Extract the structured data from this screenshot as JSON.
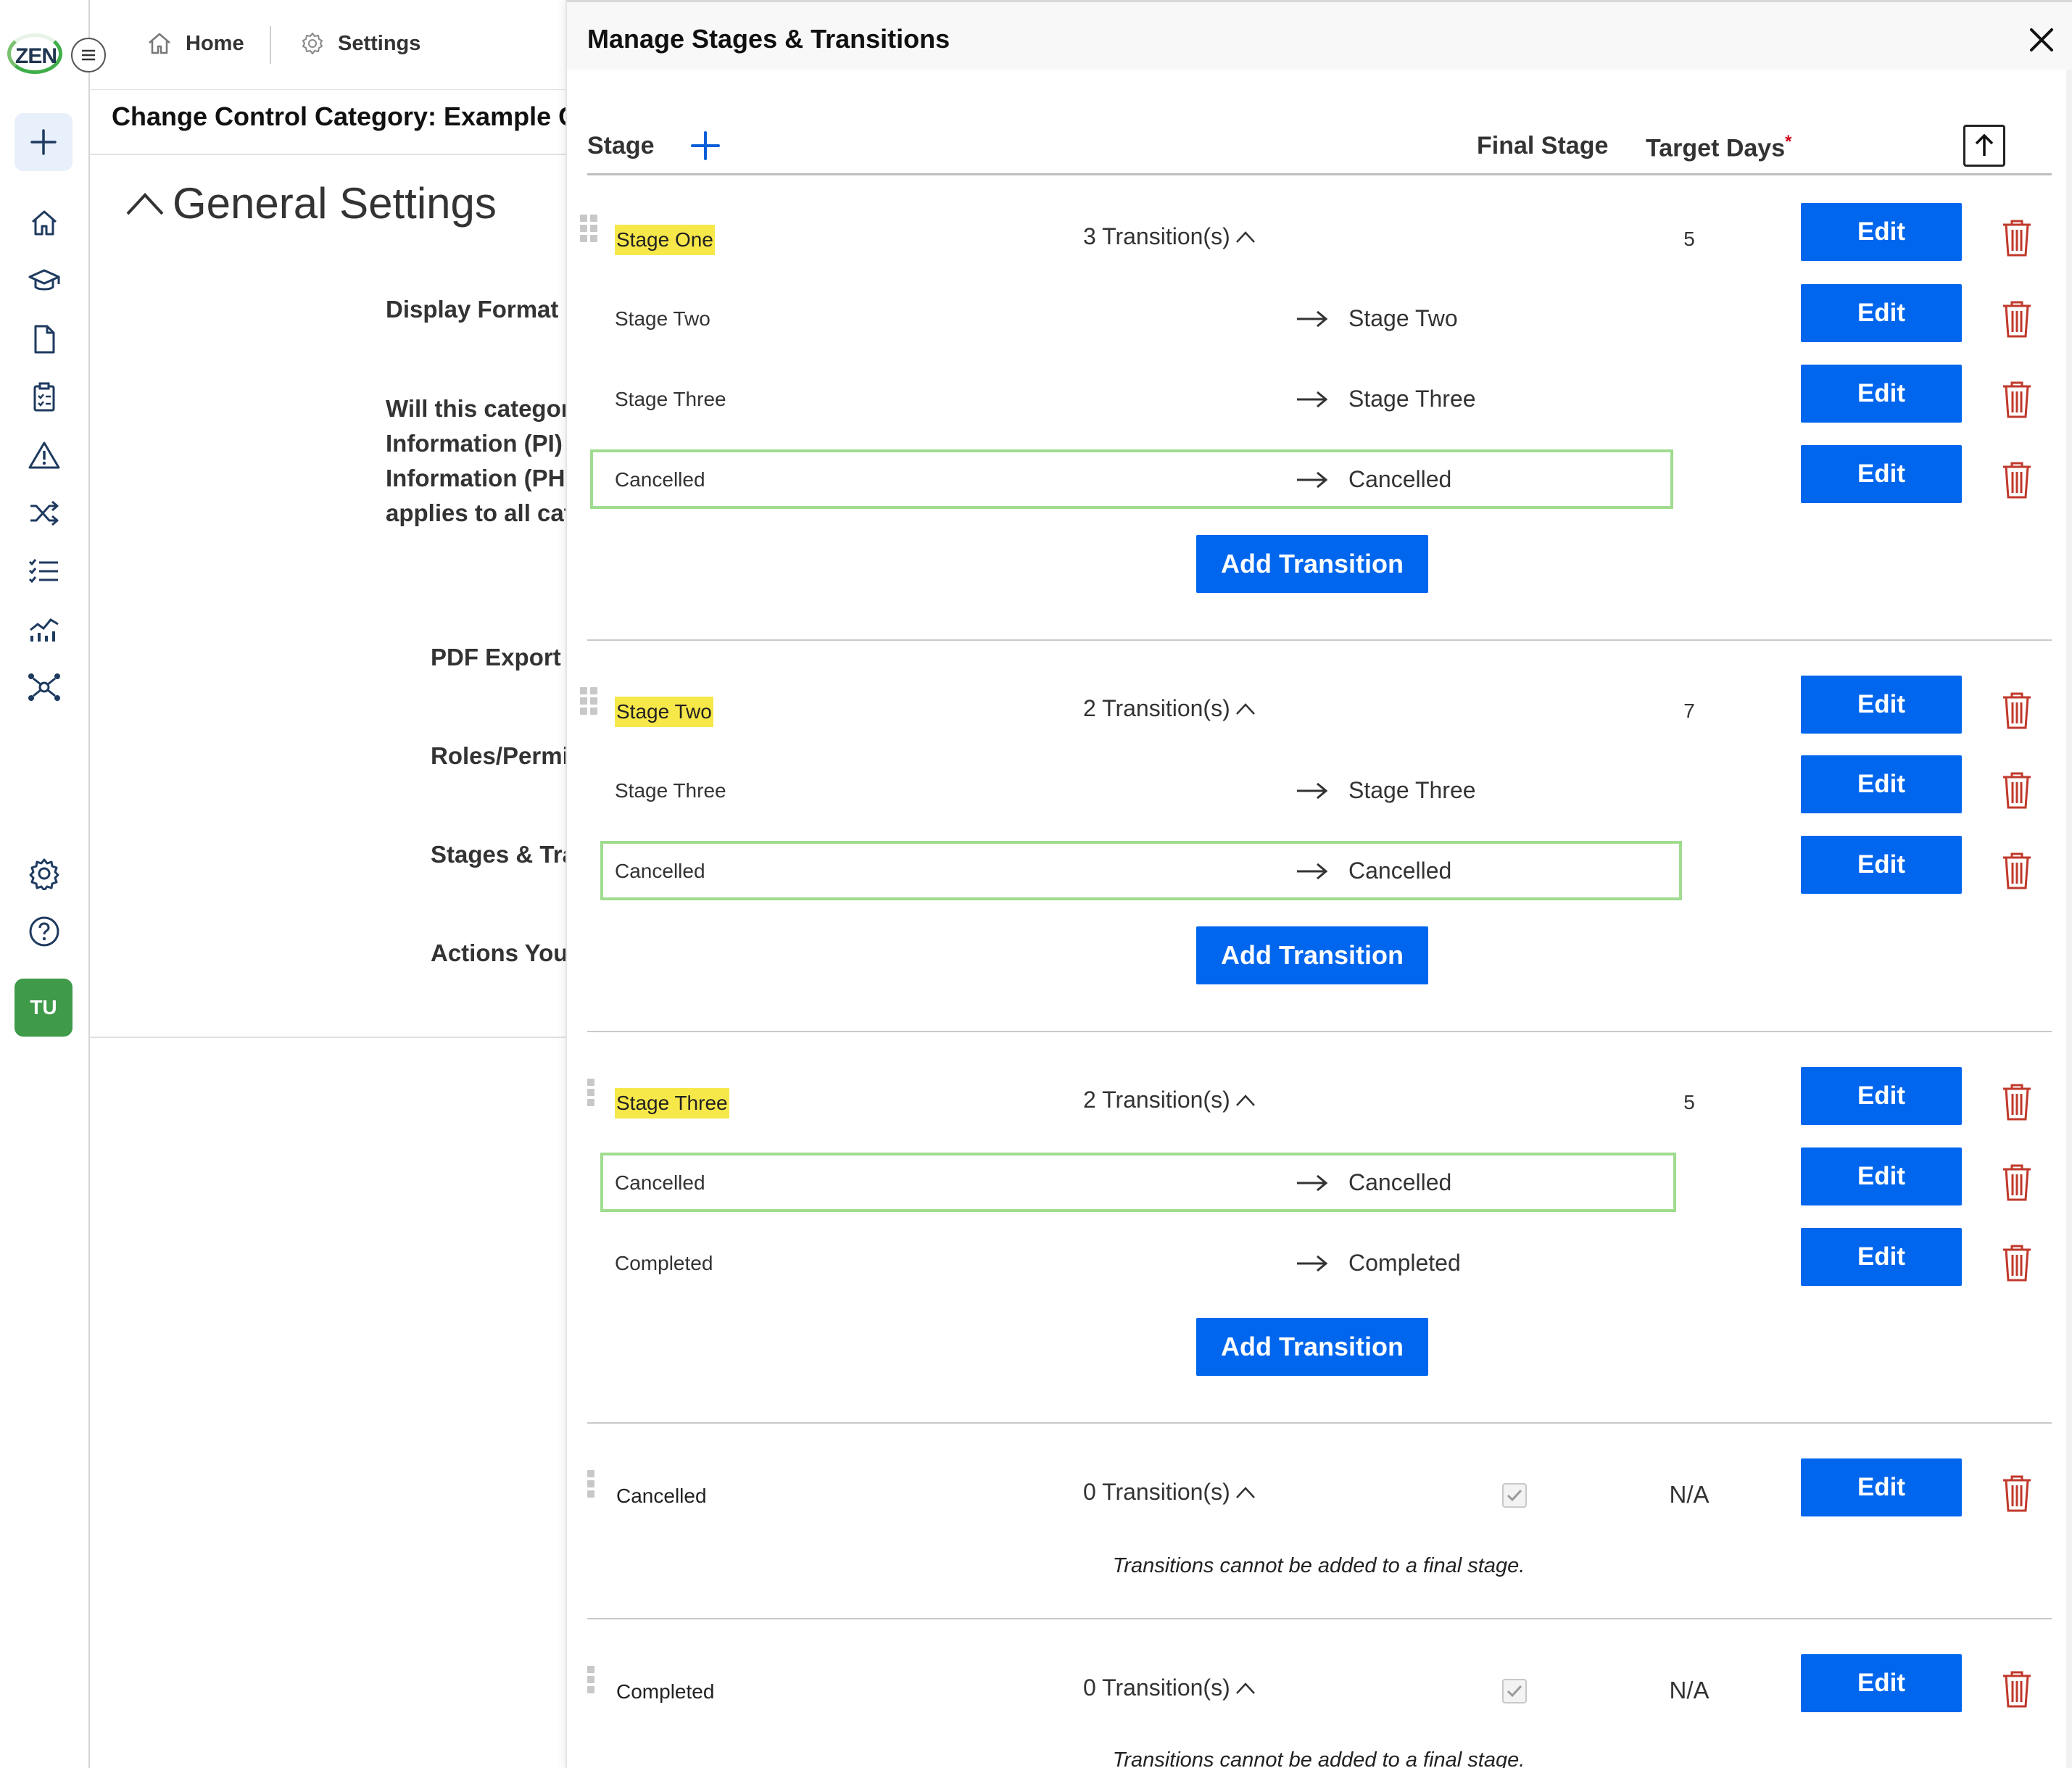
{
  "app": {
    "logo_text": "ZEN",
    "avatar_initials": "TU",
    "rail_icons": [
      "home-icon",
      "graduation-cap-icon",
      "document-icon",
      "clipboard-icon",
      "warning-icon",
      "shuffle-icon",
      "checklist-icon",
      "analytics-icon",
      "network-icon",
      "settings-icon",
      "help-icon"
    ]
  },
  "breadcrumb": {
    "home": "Home",
    "settings": "Settings"
  },
  "page": {
    "heading": "Change Control Category: Example Cha",
    "section_title": "General Settings",
    "display_format_label": "Display Format",
    "pi_lines": [
      "Will this categor",
      "Information (PI)",
      "Information (PH",
      "applies to all cat"
    ],
    "pdf_export_label": "PDF Export (",
    "roles_label": "Roles/Permi",
    "stages_label": "Stages & Tra",
    "actions_label": "Actions You"
  },
  "modal": {
    "title": "Manage Stages & Transitions",
    "columns": {
      "stage": "Stage",
      "final_stage": "Final Stage",
      "target_days": "Target Days",
      "required_mark": "*"
    },
    "edit_label": "Edit",
    "add_transition_label": "Add Transition",
    "final_stage_note": "Transitions cannot be added to a final stage.",
    "stages": [
      {
        "name": "Stage One",
        "transitions_label": "3 Transition(s)",
        "target_days": "5",
        "final": false,
        "transitions": [
          {
            "from": "Stage Two",
            "to": "Stage Two",
            "highlighted": false
          },
          {
            "from": "Stage Three",
            "to": "Stage Three",
            "highlighted": false
          },
          {
            "from": "Cancelled",
            "to": "Cancelled",
            "highlighted": true
          }
        ]
      },
      {
        "name": "Stage Two",
        "transitions_label": "2 Transition(s)",
        "target_days": "7",
        "final": false,
        "transitions": [
          {
            "from": "Stage Three",
            "to": "Stage Three",
            "highlighted": false
          },
          {
            "from": "Cancelled",
            "to": "Cancelled",
            "highlighted": true
          }
        ]
      },
      {
        "name": "Stage Three",
        "transitions_label": "2 Transition(s)",
        "target_days": "5",
        "final": false,
        "transitions": [
          {
            "from": "Cancelled",
            "to": "Cancelled",
            "highlighted": true
          },
          {
            "from": "Completed",
            "to": "Completed",
            "highlighted": false
          }
        ]
      },
      {
        "name": "Cancelled",
        "transitions_label": "0 Transition(s)",
        "target_days": "N/A",
        "final": true,
        "transitions": []
      },
      {
        "name": "Completed",
        "transitions_label": "0 Transition(s)",
        "target_days": "N/A",
        "final": true,
        "transitions": []
      }
    ]
  },
  "colors": {
    "primary": "#0066ee",
    "highlight": "#f7e84a",
    "transition_border": "#9fdc8f",
    "delete": "#c0392b",
    "avatar": "#3f9a4a"
  }
}
